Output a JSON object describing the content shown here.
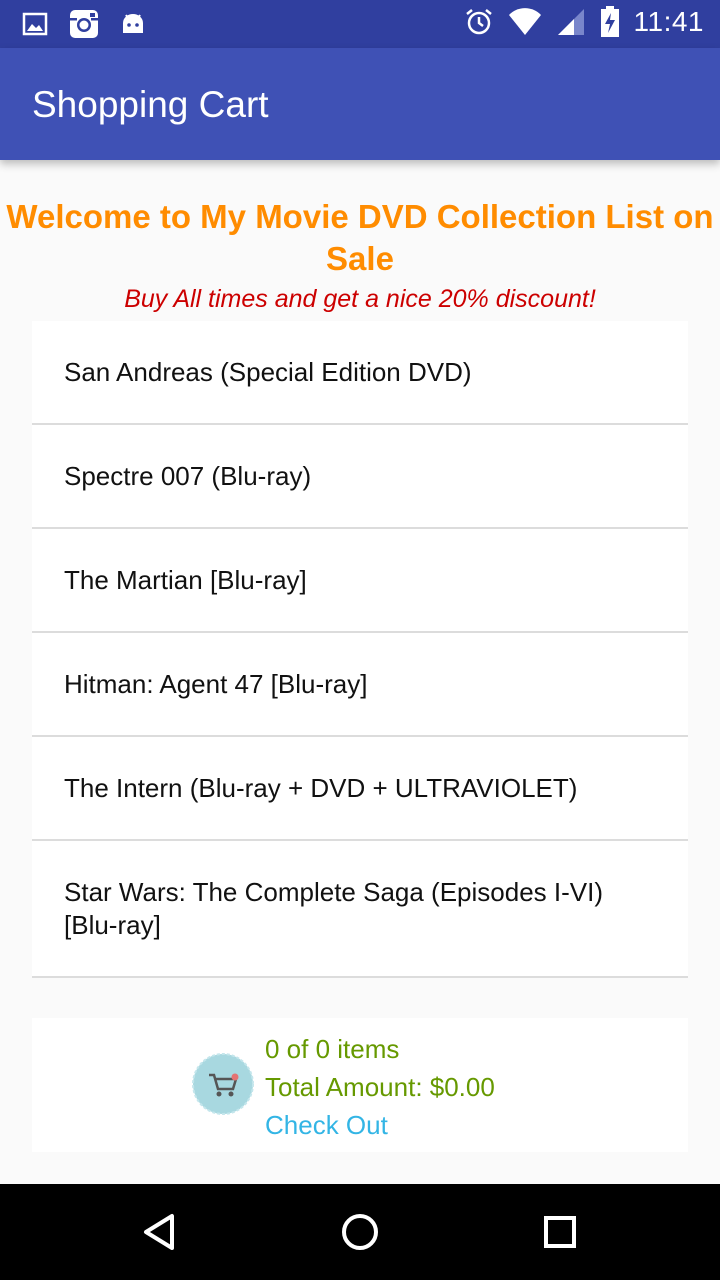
{
  "status_bar": {
    "time": "11:41",
    "icons": [
      "image-icon",
      "instagram-icon",
      "android-icon",
      "alarm-icon",
      "wifi-icon",
      "signal-icon",
      "battery-charging-icon"
    ]
  },
  "app_bar": {
    "title": "Shopping Cart"
  },
  "header": {
    "welcome": "Welcome to My Movie DVD Collection List on Sale",
    "subtitle": "Buy All times and get a nice 20% discount!"
  },
  "movies": [
    {
      "title": "San Andreas (Special Edition DVD)"
    },
    {
      "title": "Spectre 007 (Blu-ray)"
    },
    {
      "title": "The Martian [Blu-ray]"
    },
    {
      "title": "Hitman: Agent 47 [Blu-ray]"
    },
    {
      "title": "The Intern (Blu-ray + DVD + ULTRAVIOLET)"
    },
    {
      "title": "Star Wars: The Complete Saga (Episodes I-VI) [Blu-ray]"
    }
  ],
  "cart": {
    "count_text": "0 of 0 items",
    "total_text": "Total Amount: $0.00",
    "checkout_label": "Check Out"
  },
  "nav": {
    "icons": [
      "back-icon",
      "home-icon",
      "recents-icon"
    ]
  },
  "colors": {
    "status_bar": "#303f9f",
    "app_bar": "#3f51b5",
    "welcome": "#ff8c00",
    "subtitle": "#cc0000",
    "cart_text": "#669900",
    "checkout": "#33b5e5"
  }
}
